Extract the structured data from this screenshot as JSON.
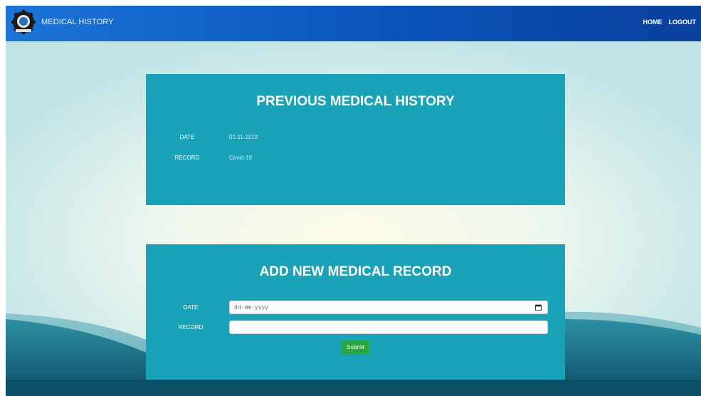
{
  "nav": {
    "brand": "MEDICAL HISTORY",
    "links": [
      {
        "label": "HOME"
      },
      {
        "label": "LOGOUT"
      }
    ]
  },
  "previous": {
    "title": "PREVIOUS MEDICAL HISTORY",
    "date_label": "DATE",
    "date_value": "01-11-2019",
    "record_label": "RECORD",
    "record_value": "Covid-19"
  },
  "new_record": {
    "title": "ADD NEW MEDICAL RECORD",
    "date_label": "DATE",
    "date_placeholder": "dd-mm-yyyy",
    "record_label": "RECORD",
    "record_value": "",
    "submit_label": "Submit"
  },
  "colors": {
    "navbar_start": "#1c74d8",
    "navbar_end": "#0a3f9e",
    "card": "#19a2b8",
    "submit": "#28a745"
  }
}
